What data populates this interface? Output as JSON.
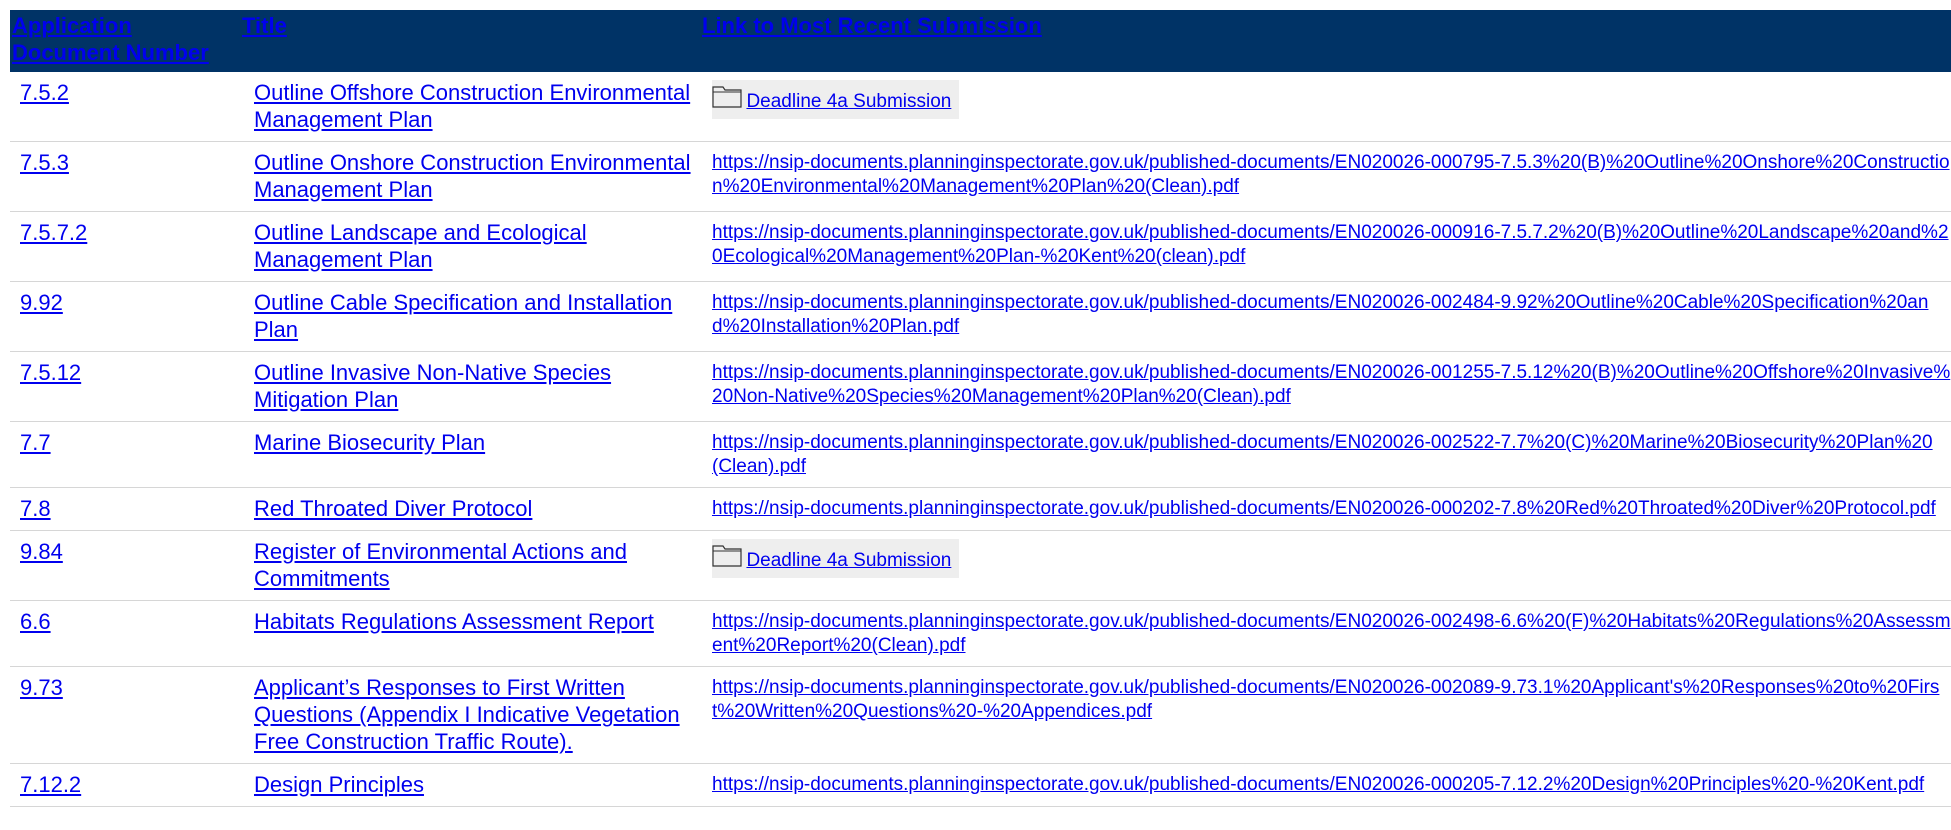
{
  "headers": [
    "Application Document Number",
    "Title",
    "Link to Most Recent Submission"
  ],
  "rows": [
    {
      "num": "7.5.2",
      "title": "Outline Offshore Construction Environmental Management Plan",
      "link_type": "folder",
      "link": "Deadline 4a Submission"
    },
    {
      "num": "7.5.3",
      "title": "Outline Onshore Construction Environmental Management Plan",
      "link_type": "url",
      "link": "https://nsip-documents.planninginspectorate.gov.uk/published-documents/EN020026-000795-7.5.3%20(B)%20Outline%20Onshore%20Construction%20Environmental%20Management%20Plan%20(Clean).pdf"
    },
    {
      "num": "7.5.7.2",
      "title": "Outline Landscape and Ecological Management Plan",
      "link_type": "url",
      "link": "https://nsip-documents.planninginspectorate.gov.uk/published-documents/EN020026-000916-7.5.7.2%20(B)%20Outline%20Landscape%20and%20Ecological%20Management%20Plan-%20Kent%20(clean).pdf"
    },
    {
      "num": "9.92",
      "title": "Outline Cable Specification and Installation Plan",
      "link_type": "url",
      "link": "https://nsip-documents.planninginspectorate.gov.uk/published-documents/EN020026-002484-9.92%20Outline%20Cable%20Specification%20and%20Installation%20Plan.pdf"
    },
    {
      "num": "7.5.12",
      "title": "Outline Invasive Non-Native Species Mitigation Plan",
      "link_type": "url",
      "link": "https://nsip-documents.planninginspectorate.gov.uk/published-documents/EN020026-001255-7.5.12%20(B)%20Outline%20Offshore%20Invasive%20Non-Native%20Species%20Management%20Plan%20(Clean).pdf"
    },
    {
      "num": "7.7",
      "title": "Marine Biosecurity Plan",
      "link_type": "url",
      "link": "https://nsip-documents.planninginspectorate.gov.uk/published-documents/EN020026-002522-7.7%20(C)%20Marine%20Biosecurity%20Plan%20(Clean).pdf"
    },
    {
      "num": "7.8",
      "title": "Red Throated Diver Protocol",
      "link_type": "url",
      "link": "https://nsip-documents.planninginspectorate.gov.uk/published-documents/EN020026-000202-7.8%20Red%20Throated%20Diver%20Protocol.pdf"
    },
    {
      "num": "9.84",
      "title": "Register of Environmental Actions and Commitments",
      "link_type": "folder",
      "link": "Deadline 4a Submission"
    },
    {
      "num": "6.6",
      "title": "Habitats Regulations Assessment Report",
      "link_type": "url",
      "link": "https://nsip-documents.planninginspectorate.gov.uk/published-documents/EN020026-002498-6.6%20(F)%20Habitats%20Regulations%20Assessment%20Report%20(Clean).pdf"
    },
    {
      "num": "9.73",
      "title": "Applicant’s Responses to First Written Questions (Appendix I Indicative Vegetation Free Construction Traffic Route).",
      "link_type": "url",
      "link": "https://nsip-documents.planninginspectorate.gov.uk/published-documents/EN020026-002089-9.73.1%20Applicant's%20Responses%20to%20First%20Written%20Questions%20-%20Appendices.pdf"
    },
    {
      "num": "7.12.2",
      "title": "Design Principles",
      "link_type": "url",
      "link": "https://nsip-documents.planninginspectorate.gov.uk/published-documents/EN020026-000205-7.12.2%20Design%20Principles%20-%20Kent.pdf"
    }
  ],
  "colors": {
    "header_bg": "#003366",
    "link": "#0000ee",
    "folder_bg": "#eeeeee"
  },
  "icons": {
    "folder": "folder-icon"
  }
}
